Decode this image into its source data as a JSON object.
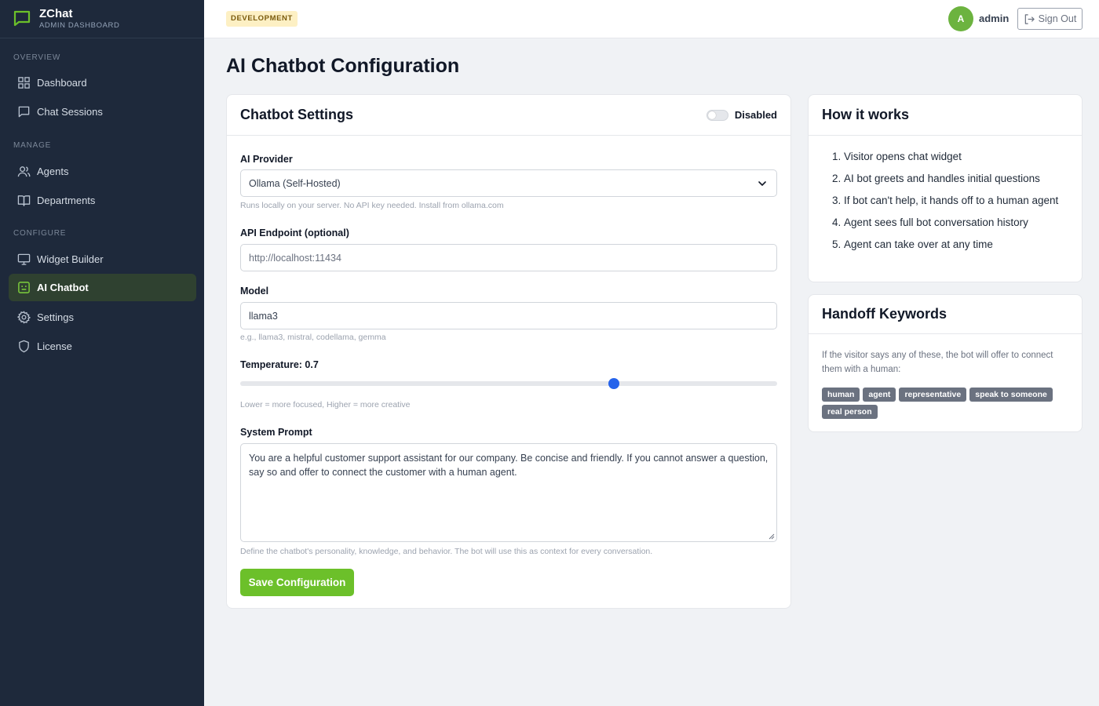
{
  "brand": {
    "name": "ZChat",
    "subtitle": "ADMIN DASHBOARD"
  },
  "sidebar": {
    "sections": [
      {
        "title": "OVERVIEW"
      },
      {
        "title": "MANAGE"
      },
      {
        "title": "CONFIGURE"
      }
    ],
    "items": [
      {
        "label": "Dashboard",
        "icon": "grid-icon"
      },
      {
        "label": "Chat Sessions",
        "icon": "chat-bubble-icon"
      },
      {
        "label": "Agents",
        "icon": "users-icon"
      },
      {
        "label": "Departments",
        "icon": "book-icon"
      },
      {
        "label": "Widget Builder",
        "icon": "monitor-icon"
      },
      {
        "label": "AI Chatbot",
        "icon": "bot-icon",
        "active": true
      },
      {
        "label": "Settings",
        "icon": "gear-icon"
      },
      {
        "label": "License",
        "icon": "shield-icon"
      }
    ]
  },
  "topbar": {
    "environment": "DEVELOPMENT",
    "avatar_initial": "A",
    "username": "admin",
    "signout_label": "Sign Out"
  },
  "page": {
    "title": "AI Chatbot Configuration"
  },
  "settings": {
    "title": "Chatbot Settings",
    "toggle_label": "Disabled",
    "enabled": false,
    "provider": {
      "label": "AI Provider",
      "value": "Ollama (Self-Hosted)",
      "help": "Runs locally on your server. No API key needed. Install from ollama.com"
    },
    "endpoint": {
      "label": "API Endpoint (optional)",
      "placeholder": "http://localhost:11434"
    },
    "model": {
      "label": "Model",
      "value": "llama3",
      "help": "e.g., llama3, mistral, codellama, gemma"
    },
    "temperature": {
      "label": "Temperature: 0.7",
      "value": 0.7,
      "min": 0,
      "max": 1,
      "help": "Lower = more focused, Higher = more creative"
    },
    "system_prompt": {
      "label": "System Prompt",
      "value": "You are a helpful customer support assistant for our company. Be concise and friendly. If you cannot answer a question, say so and offer to connect the customer with a human agent.",
      "help": "Define the chatbot's personality, knowledge, and behavior. The bot will use this as context for every conversation."
    },
    "save_label": "Save Configuration"
  },
  "how_it_works": {
    "title": "How it works",
    "steps": [
      "Visitor opens chat widget",
      "AI bot greets and handles initial questions",
      "If bot can't help, it hands off to a human agent",
      "Agent sees full bot conversation history",
      "Agent can take over at any time"
    ]
  },
  "handoff": {
    "title": "Handoff Keywords",
    "description": "If the visitor says any of these, the bot will offer to connect them with a human:",
    "keywords": [
      "human",
      "agent",
      "representative",
      "speak to someone",
      "real person"
    ]
  },
  "colors": {
    "sidebar_bg": "#1e293b",
    "accent": "#6cc02a",
    "slider": "#2563eb",
    "env_badge_bg": "#fdf0c4"
  }
}
